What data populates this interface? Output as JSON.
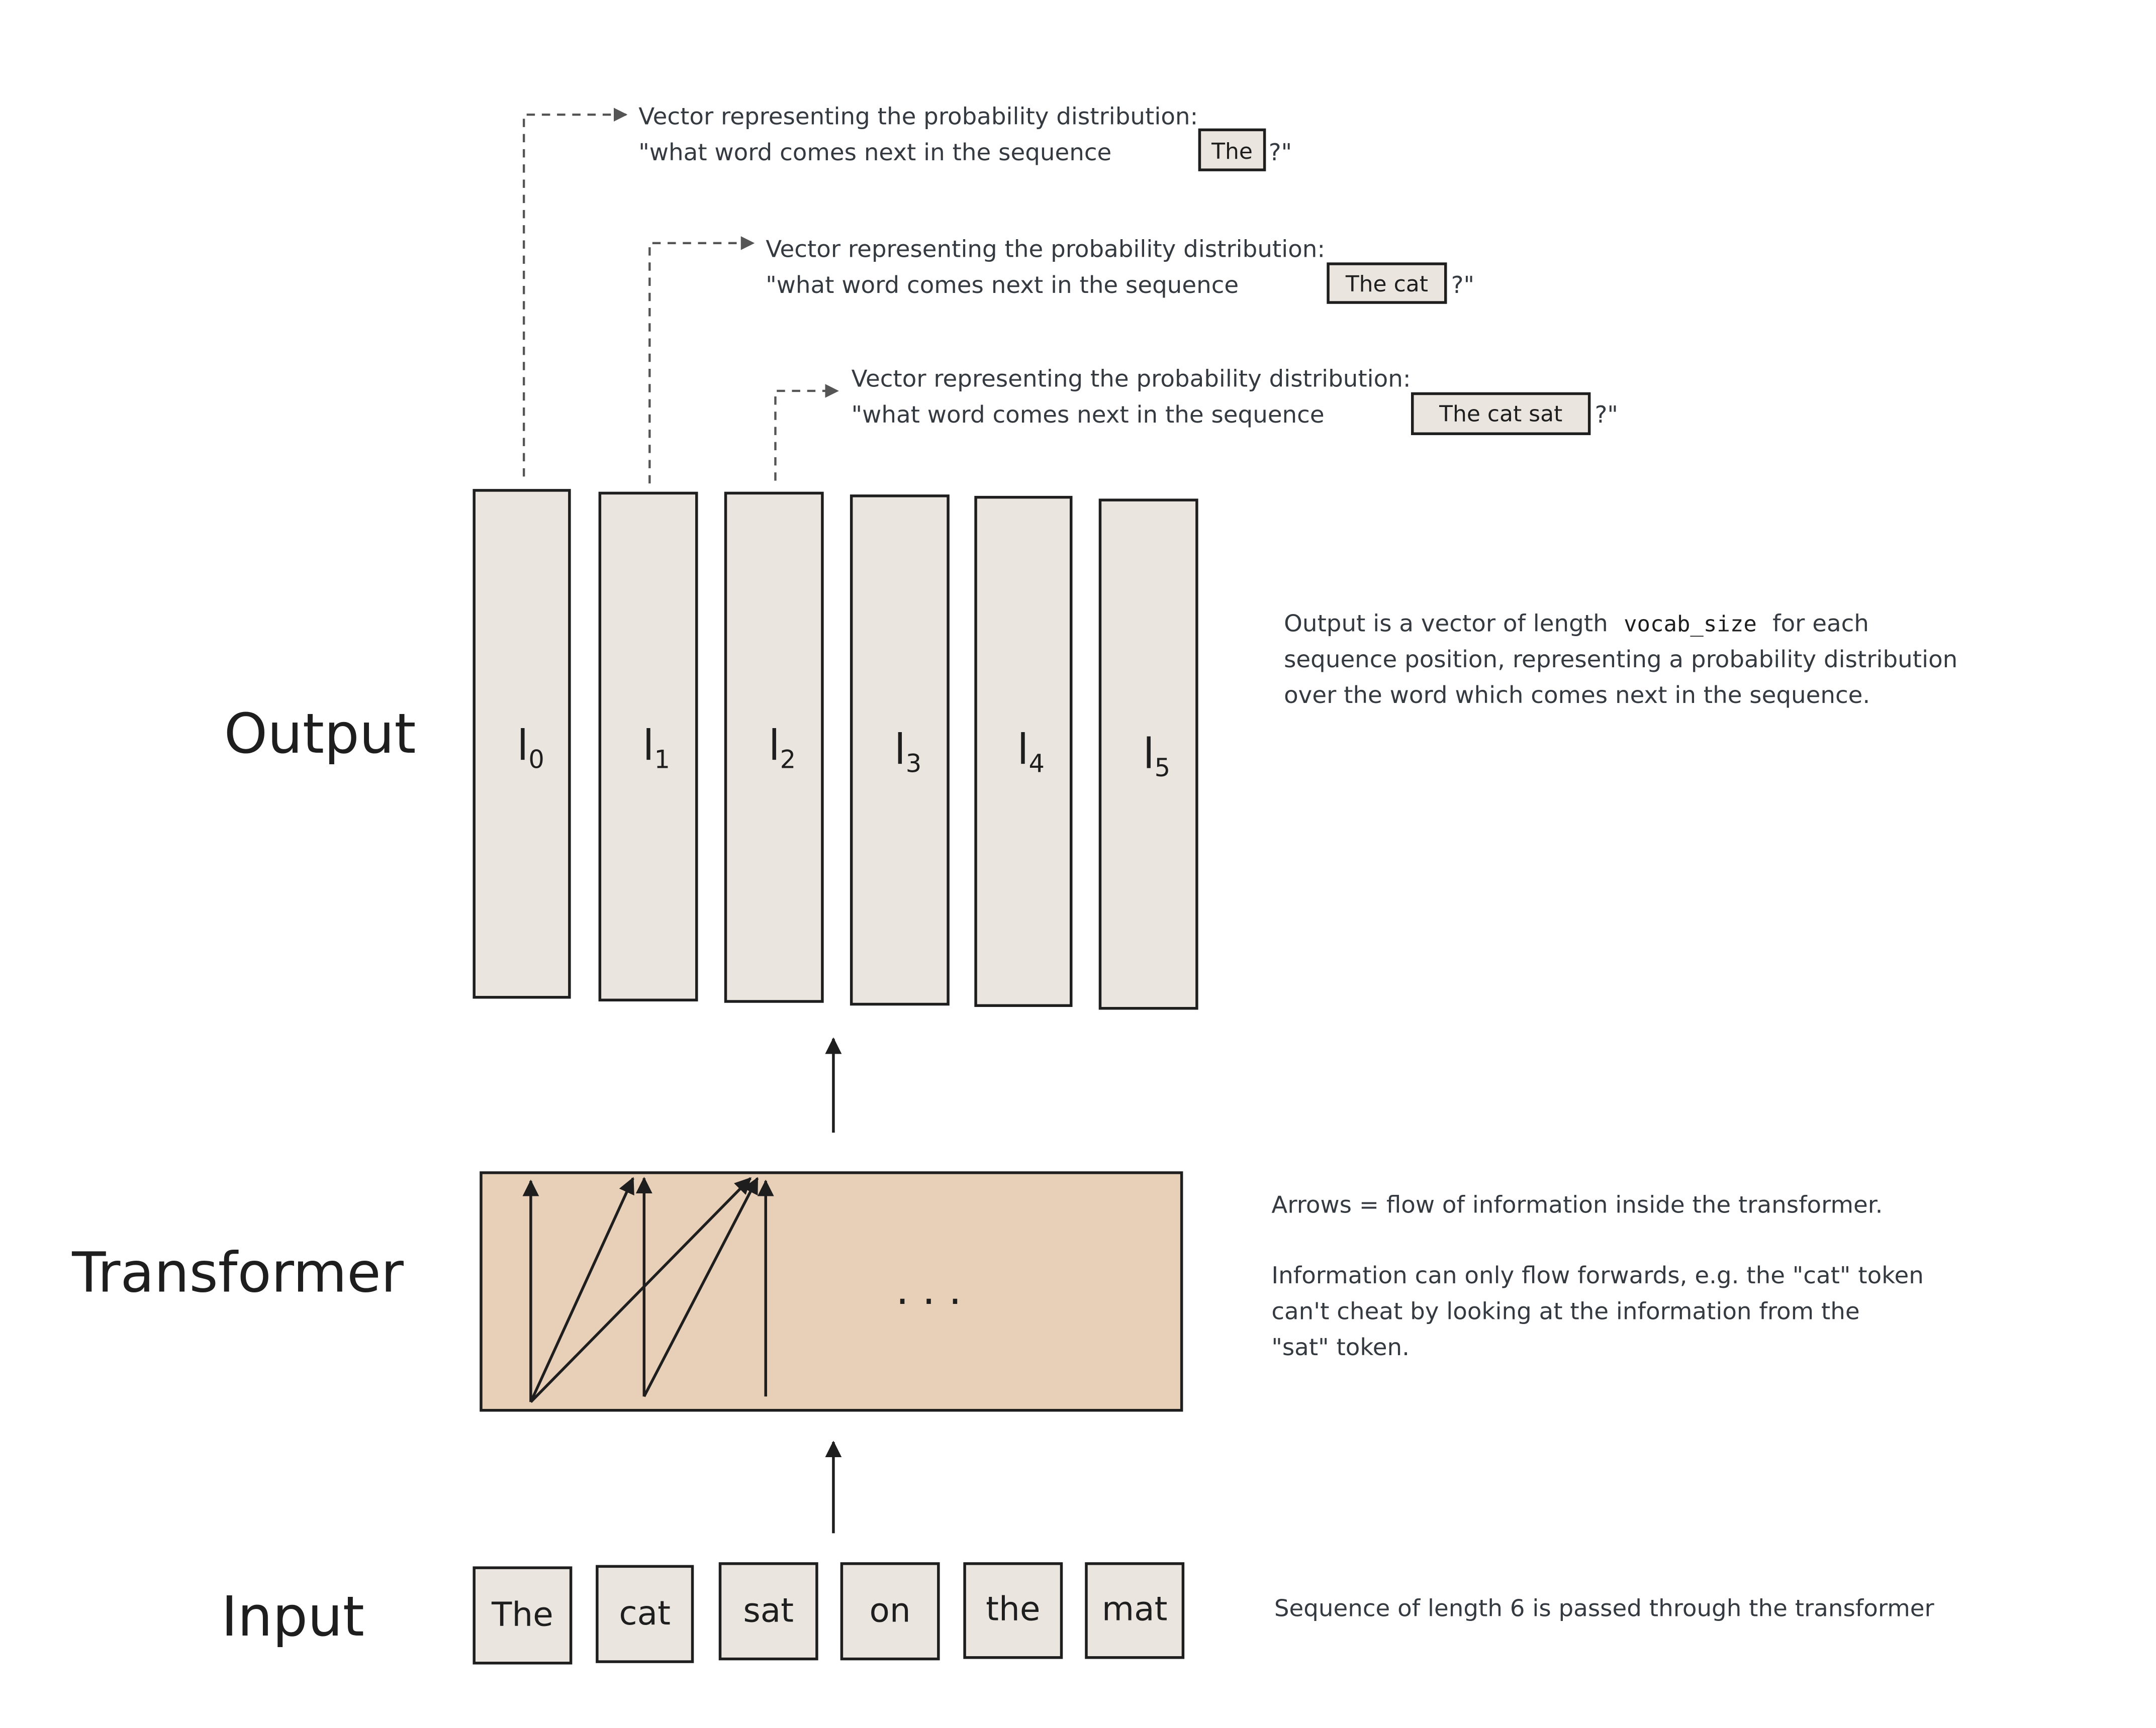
{
  "labels": {
    "output": "Output",
    "transformer": "Transformer",
    "input": "Input"
  },
  "input_tokens": [
    "The",
    "cat",
    "sat",
    "on",
    "the",
    "mat"
  ],
  "logits": [
    {
      "base": "l",
      "sub": "0"
    },
    {
      "base": "l",
      "sub": "1"
    },
    {
      "base": "l",
      "sub": "2"
    },
    {
      "base": "l",
      "sub": "3"
    },
    {
      "base": "l",
      "sub": "4"
    },
    {
      "base": "l",
      "sub": "5"
    }
  ],
  "ellipsis": ". . .",
  "callouts": [
    {
      "line1": "Vector representing the probability distribution:",
      "prefix": "\"what word comes next in the sequence",
      "boxed": "The",
      "suffix": "?\""
    },
    {
      "line1": "Vector representing the probability distribution:",
      "prefix": "\"what word comes next in the sequence",
      "boxed": "The cat",
      "suffix": "?\""
    },
    {
      "line1": "Vector representing the probability distribution:",
      "prefix": "\"what word comes next in the sequence",
      "boxed": "The cat sat",
      "suffix": "?\""
    }
  ],
  "notes": {
    "output": {
      "line1_pre": "Output is a vector of length",
      "code": "vocab_size",
      "line1_post": "for each",
      "line2": "sequence position, representing a probability distribution",
      "line3": "over the word which comes next in the sequence."
    },
    "transformer": {
      "line1": "Arrows = flow of information inside the transformer.",
      "line2": "Information can only flow forwards, e.g. the \"cat\" token",
      "line3": "can't cheat by looking at the information from the",
      "line4": "\"sat\" token."
    },
    "input": {
      "line1": "Sequence of length 6 is passed through the transformer"
    }
  },
  "colors": {
    "token_fill": "#ebe5df",
    "transformer_fill": "#e8d0b8",
    "stroke": "#1e1e1e",
    "note_text": "#343a40",
    "dashed": "#555555"
  }
}
